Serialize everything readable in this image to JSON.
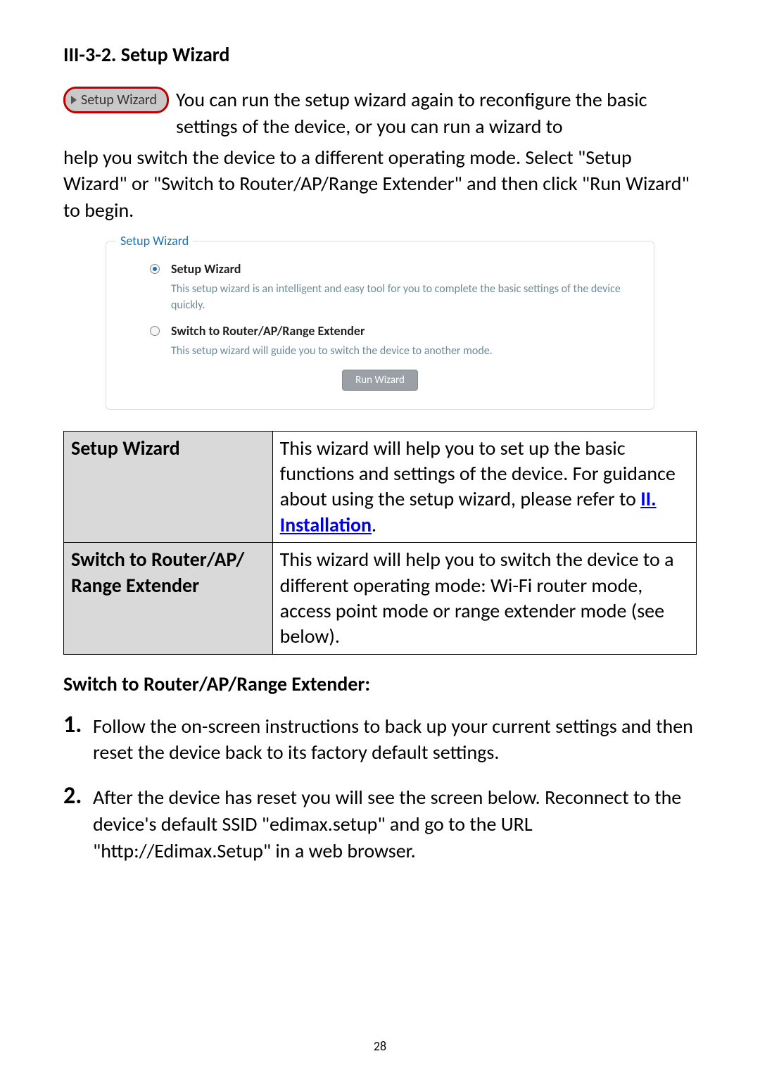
{
  "heading": "III-3-2. Setup Wizard",
  "badge_label": "Setup Wizard",
  "intro_line1": "You can run the setup wizard again to reconfigure the basic settings of the device, or you can run a wizard to",
  "intro_rest": "help you switch the device to a different operating mode. Select \"Setup Wizard\" or \"Switch to Router/AP/Range Extender\" and then click \"Run Wizard\" to begin.",
  "fieldset": {
    "legend": "Setup Wizard",
    "option1": {
      "title": "Setup Wizard",
      "desc": "This setup wizard is an intelligent and easy tool for you to complete the basic settings of the device quickly."
    },
    "option2": {
      "title": "Switch to Router/AP/Range Extender",
      "desc": "This setup wizard will guide you to switch the device to another mode."
    },
    "run_button": "Run Wizard"
  },
  "table": {
    "row1_label": "Setup Wizard",
    "row1_text_a": "This wizard will help you to set up the basic functions and settings of the device. For guidance about using the setup wizard, please refer to ",
    "row1_link": "II. Installation",
    "row1_text_b": ".",
    "row2_label": "Switch to Router/AP/ Range Extender",
    "row2_text": "This wizard will help you to switch the device to a different operating mode: Wi-Fi router mode, access point mode or range extender mode (see below)."
  },
  "subheading": "Switch to Router/AP/Range Extender:",
  "steps": {
    "s1_num": "1.",
    "s1_text": "Follow the on-screen instructions to back up your current settings and then reset the device back to its factory default settings.",
    "s2_num": "2.",
    "s2_text": "After the device has reset you will see the screen below. Reconnect to the device's default SSID \"edimax.setup\" and go to the URL \"http://Edimax.Setup\" in a web browser."
  },
  "page_number": "28"
}
